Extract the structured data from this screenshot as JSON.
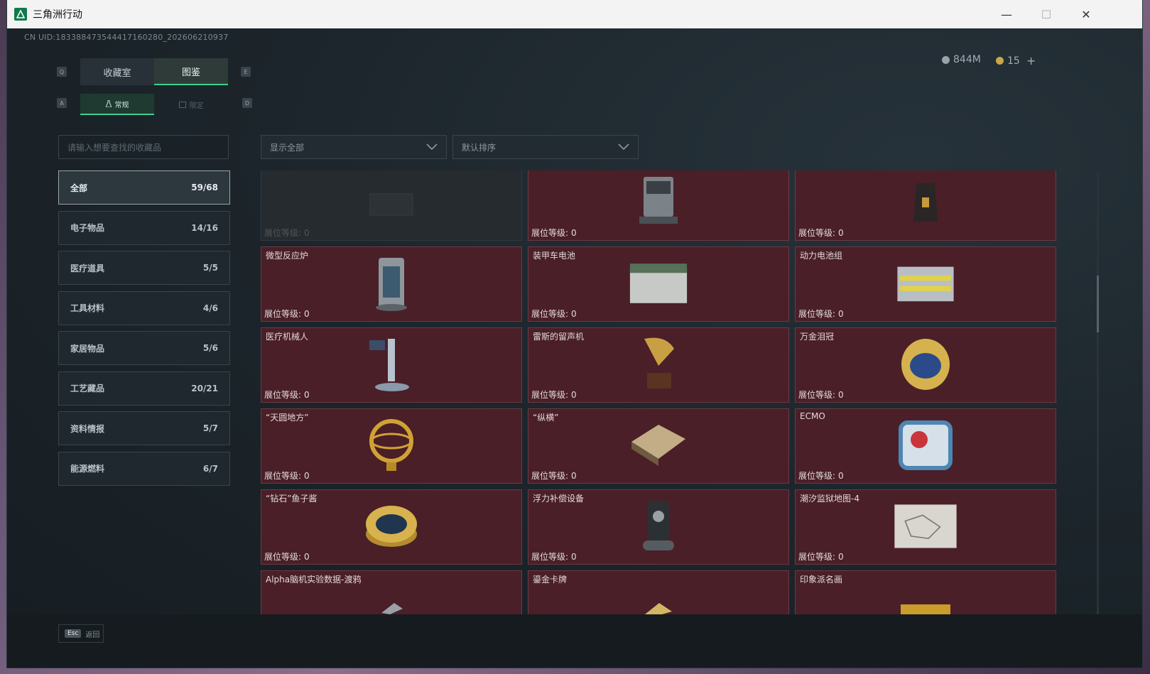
{
  "window": {
    "title": "三角洲行动",
    "min_glyph": "—",
    "max_glyph": "☐",
    "close_glyph": "✕"
  },
  "uid": "CN UID:1833884735444171602​80_202606210937",
  "currency": {
    "silver": "844M",
    "gold": "15",
    "add_glyph": "+"
  },
  "keys": {
    "q": "Q",
    "e": "E",
    "a": "A",
    "d": "D"
  },
  "main_tabs": [
    {
      "label": "收藏室"
    },
    {
      "label": "图鉴"
    }
  ],
  "sub_tabs": [
    {
      "label": "常规"
    },
    {
      "label": "限定"
    }
  ],
  "search": {
    "placeholder": "请输入想要查找的收藏品"
  },
  "filters": {
    "display": "显示全部",
    "sort": "默认排序"
  },
  "categories": [
    {
      "label": "全部",
      "count": "59/68"
    },
    {
      "label": "电子物品",
      "count": "14/16"
    },
    {
      "label": "医疗道具",
      "count": "5/5"
    },
    {
      "label": "工具材料",
      "count": "4/6"
    },
    {
      "label": "家居物品",
      "count": "5/6"
    },
    {
      "label": "工艺藏品",
      "count": "20/21"
    },
    {
      "label": "资料情报",
      "count": "5/7"
    },
    {
      "label": "能源燃料",
      "count": "6/7"
    }
  ],
  "level_label": "展位等级:",
  "items": [
    {
      "name": "",
      "level": "0",
      "icon": "locked-item-icon"
    },
    {
      "name": "",
      "level": "0",
      "icon": "sweeping-robot-icon"
    },
    {
      "name": "",
      "level": "0",
      "icon": "coffee-bag-icon"
    },
    {
      "name": "微型反应炉",
      "level": "0",
      "icon": "micro-reactor-icon"
    },
    {
      "name": "装甲车电池",
      "level": "0",
      "icon": "armored-battery-icon"
    },
    {
      "name": "动力电池组",
      "level": "0",
      "icon": "power-battery-pack-icon"
    },
    {
      "name": "医疗机械人",
      "level": "0",
      "icon": "medical-robot-icon"
    },
    {
      "name": "雷斯的留声机",
      "level": "0",
      "icon": "gramophone-icon"
    },
    {
      "name": "万金泪冠",
      "level": "0",
      "icon": "jeweled-crown-icon"
    },
    {
      "name": "“天圆地方”",
      "level": "0",
      "icon": "armillary-sphere-icon"
    },
    {
      "name": "“纵横”",
      "level": "0",
      "icon": "chessboard-icon"
    },
    {
      "name": "ECMO",
      "level": "0",
      "icon": "ecmo-machine-icon"
    },
    {
      "name": "“钻石”鱼子酱",
      "level": "0",
      "icon": "caviar-tin-icon"
    },
    {
      "name": "浮力补偿设备",
      "level": "0",
      "icon": "buoyancy-device-icon"
    },
    {
      "name": "潮汐监狱地图-4",
      "level": "0",
      "icon": "prison-map-icon"
    },
    {
      "name": "Alpha脑机实验数据-渡鸦",
      "level": "",
      "icon": "data-drive-icon"
    },
    {
      "name": "鎏金卡牌",
      "level": "",
      "icon": "gold-card-icon"
    },
    {
      "name": "印象派名画",
      "level": "",
      "icon": "painting-icon"
    }
  ],
  "footer": {
    "esc_key": "Esc",
    "back_label": "返回"
  },
  "colors": {
    "accent": "#3fcf8e",
    "card_bg": "#4a1f28",
    "window_bg": "#1b2328"
  }
}
